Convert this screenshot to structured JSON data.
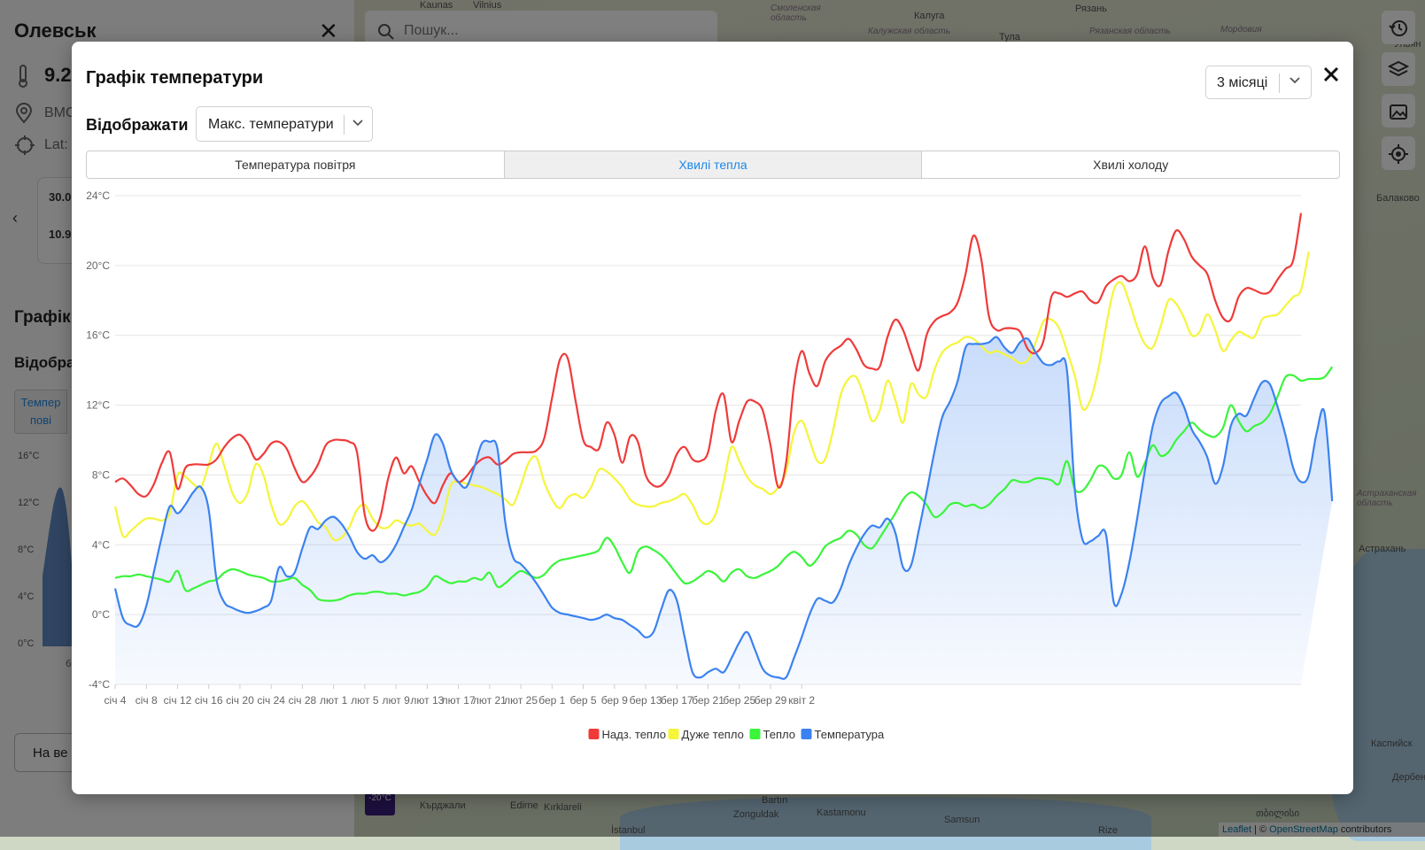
{
  "map": {
    "labels": [
      "Kaunas",
      "Vilnius",
      "Смоленская область",
      "Калуга",
      "Рязань",
      "Тула",
      "Калужская область",
      "Рязанская область",
      "Мордовия",
      "Ульян",
      "Балаково",
      "Астраханская область",
      "Астрахань",
      "Каспийск",
      "Дербент",
      "Bartın",
      "Zonguldak",
      "Kastamonu",
      "Samsun",
      "Edirne",
      "Kırklareli",
      "Кърджали",
      "İstanbul",
      "Rize",
      "თბილისი"
    ],
    "badge": "-20°C"
  },
  "search": {
    "placeholder": "Пошук..."
  },
  "attribution": {
    "leaflet": "Leaflet",
    "sep": " | © ",
    "osm": "OpenStreetMap",
    "rest": " contributors"
  },
  "sidepanel": {
    "title": "Олевськ",
    "temp": "9.2",
    "station": "ВМС",
    "lat": "Lat:",
    "card_top": "30.0",
    "card_bottom": "10.9",
    "chart_heading": "Графік",
    "display_label": "Відобра",
    "tab_label_1": "Темпер",
    "tab_label_2": "пові",
    "y_ticks": [
      "16°C",
      "12°C",
      "8°C",
      "4°C",
      "0°C"
    ],
    "x_tick": "б",
    "button": "На ве"
  },
  "modal": {
    "title": "Графік температури",
    "period": "3 місяці",
    "show_label": "Відображати",
    "select_value": "Макс. температури",
    "tabs": [
      {
        "label": "Температура повітря",
        "active": false
      },
      {
        "label": "Хвилі тепла",
        "active": true
      },
      {
        "label": "Хвилі холоду",
        "active": false
      }
    ]
  },
  "chart_data": {
    "type": "line",
    "ylim": [
      -4,
      24
    ],
    "yticks": [
      "-4°C",
      "0°C",
      "4°C",
      "8°C",
      "12°C",
      "16°C",
      "20°C",
      "24°C"
    ],
    "x_tick_labels": [
      "січ 4",
      "січ 8",
      "січ 12",
      "січ 16",
      "січ 20",
      "січ 24",
      "січ 28",
      "лют 1",
      "лют 5",
      "лют 9",
      "лют 13",
      "лют 17",
      "лют 21",
      "лют 25",
      "бер 1",
      "бер 5",
      "бер 9",
      "бер 13",
      "бер 17",
      "бер 21",
      "бер 25",
      "бер 29",
      "квіт 2"
    ],
    "legend": "bottom-center",
    "grid": true,
    "colors": {
      "extreme": "#f03a3a",
      "strong": "#f5f53a",
      "warm": "#3af53a",
      "temp": "#3b82f0"
    },
    "series": [
      {
        "name": "Надз. тепло",
        "color": "#f03a3a",
        "values": [
          7.6,
          7.8,
          7.4,
          6.9,
          6.8,
          7.5,
          8.7,
          9.3,
          7.2,
          8.4,
          8.6,
          8.6,
          8.6,
          8.9,
          9.6,
          10.1,
          10.3,
          9.8,
          8.9,
          9.2,
          9.8,
          9.9,
          9.5,
          8.4,
          7.6,
          7.9,
          8.6,
          9.7,
          10.0,
          10.0,
          9.9,
          9.3,
          5.7,
          4.8,
          5.6,
          7.8,
          9.0,
          8.1,
          8.5,
          7.6,
          6.8,
          6.4,
          7.4,
          8.1,
          7.6,
          7.9,
          8.5,
          8.9,
          9.0,
          8.6,
          8.8,
          9.2,
          9.3,
          9.3,
          9.4,
          10.1,
          12.4,
          14.6,
          14.7,
          12.3,
          10.0,
          9.6,
          9.5,
          11.0,
          10.3,
          8.7,
          10.2,
          9.9,
          8.0,
          7.4,
          7.4,
          8.0,
          9.2,
          9.6,
          8.9,
          8.8,
          9.3,
          11.7,
          12.6,
          9.9,
          11.1,
          12.2,
          12.2,
          11.7,
          9.7,
          7.3,
          8.7,
          13.1,
          15.1,
          13.8,
          13.1,
          14.5,
          15.1,
          15.4,
          15.8,
          15.2,
          14.3,
          14.1,
          14.2,
          15.9,
          16.9,
          16.3,
          15.0,
          14.0,
          16.0,
          16.8,
          17.1,
          17.3,
          17.9,
          19.5,
          21.7,
          20.4,
          17.1,
          16.3,
          16.4,
          16.4,
          16.2,
          15.2,
          15.0,
          15.7,
          18.2,
          18.4,
          18.2,
          18.4,
          18.5,
          18.0,
          17.9,
          18.8,
          19.2,
          19.4,
          19.1,
          19.5,
          21.1,
          19.3,
          18.9,
          20.8,
          22.0,
          21.5,
          20.5,
          20.0,
          19.5,
          18.0,
          17.0,
          16.9,
          18.2,
          18.7,
          18.6,
          18.4,
          18.5,
          19.2,
          19.8,
          20.3,
          23.0
        ]
      },
      {
        "name": "Дуже тепло",
        "color": "#f5f53a",
        "values": [
          6.2,
          4.5,
          4.8,
          5.2,
          5.5,
          5.5,
          5.4,
          5.8,
          8.0,
          7.9,
          7.5,
          7.3,
          8.6,
          9.8,
          8.5,
          7.0,
          6.4,
          7.0,
          8.6,
          8.0,
          6.3,
          5.2,
          5.4,
          6.2,
          6.5,
          6.0,
          5.3,
          5.0,
          4.3,
          4.4,
          5.0,
          6.0,
          6.3,
          5.5,
          5.0,
          5.0,
          5.4,
          5.2,
          5.1,
          5.2,
          4.8,
          4.6,
          5.6,
          7.4,
          7.6,
          7.5,
          7.4,
          7.3,
          7.1,
          6.9,
          6.6,
          6.3,
          7.4,
          8.7,
          9.0,
          7.6,
          6.6,
          6.1,
          6.7,
          6.9,
          6.7,
          7.3,
          8.3,
          8.2,
          7.8,
          7.3,
          6.6,
          6.3,
          6.2,
          6.2,
          6.4,
          6.5,
          6.7,
          6.9,
          6.3,
          5.4,
          5.2,
          5.8,
          7.6,
          9.6,
          8.8,
          7.9,
          7.4,
          7.2,
          6.9,
          7.3,
          8.2,
          10.4,
          11.1,
          10.0,
          8.8,
          8.9,
          10.5,
          12.6,
          13.5,
          13.6,
          12.5,
          11.1,
          11.7,
          13.4,
          12.3,
          11.0,
          13.2,
          12.6,
          12.5,
          14.0,
          15.0,
          15.4,
          15.6,
          15.9,
          15.8,
          15.4,
          15.0,
          15.1,
          14.9,
          14.7,
          14.4,
          14.6,
          15.6,
          16.8,
          16.9,
          16.4,
          15.1,
          13.7,
          11.8,
          12.3,
          14.0,
          16.5,
          18.6,
          19.0,
          17.9,
          16.5,
          15.5,
          15.3,
          16.5,
          18.0,
          17.8,
          17.0,
          16.0,
          16.2,
          17.2,
          16.3,
          15.1,
          15.7,
          16.2,
          16.0,
          15.9,
          16.9,
          17.1,
          17.2,
          17.7,
          18.2,
          18.6,
          20.8
        ]
      },
      {
        "name": "Тепло",
        "color": "#3af53a",
        "values": [
          2.1,
          2.2,
          2.2,
          2.3,
          2.2,
          2.1,
          2.0,
          1.9,
          2.5,
          1.4,
          1.5,
          1.7,
          1.9,
          2.0,
          2.4,
          2.6,
          2.5,
          2.3,
          2.2,
          2.1,
          1.9,
          1.9,
          2.0,
          2.1,
          1.7,
          1.4,
          0.9,
          0.8,
          0.8,
          0.9,
          1.1,
          1.2,
          1.2,
          1.3,
          1.3,
          1.2,
          1.2,
          1.1,
          1.2,
          1.3,
          1.6,
          2.2,
          2.0,
          1.8,
          1.9,
          1.9,
          2.1,
          2.0,
          2.4,
          1.6,
          1.8,
          2.2,
          2.5,
          2.3,
          2.1,
          2.3,
          2.8,
          3.1,
          3.2,
          3.3,
          3.4,
          3.5,
          3.7,
          4.4,
          3.9,
          3.0,
          2.4,
          3.6,
          3.9,
          3.7,
          3.4,
          2.9,
          2.3,
          1.8,
          1.9,
          2.2,
          2.5,
          2.3,
          1.9,
          2.4,
          2.6,
          2.2,
          2.1,
          2.3,
          2.5,
          2.8,
          3.3,
          3.6,
          3.3,
          2.8,
          3.2,
          3.9,
          4.2,
          4.4,
          4.8,
          4.6,
          4.0,
          3.8,
          4.4,
          5.1,
          5.8,
          6.6,
          7.0,
          6.8,
          6.3,
          5.6,
          5.8,
          6.3,
          6.4,
          6.2,
          6.3,
          6.1,
          6.3,
          6.8,
          7.2,
          7.7,
          7.6,
          7.6,
          7.8,
          7.8,
          7.7,
          7.5,
          8.8,
          7.2,
          7.1,
          7.7,
          8.5,
          8.4,
          7.8,
          8.0,
          9.3,
          7.9,
          8.7,
          9.7,
          9.1,
          9.3,
          10.0,
          10.5,
          11.0,
          10.6,
          10.3,
          10.2,
          10.7,
          12.0,
          11.1,
          10.5,
          10.8,
          11.0,
          11.5,
          12.5,
          13.6,
          13.7,
          13.4,
          13.5,
          13.5,
          13.6,
          14.2
        ]
      },
      {
        "name": "Температура",
        "color": "#3b82f0",
        "values": [
          1.5,
          -0.2,
          -0.6,
          -0.6,
          0.5,
          2.5,
          4.5,
          6.2,
          5.8,
          6.3,
          7.0,
          7.3,
          6.0,
          2.0,
          0.7,
          0.4,
          0.2,
          0.1,
          0.2,
          0.4,
          0.8,
          2.7,
          2.2,
          2.4,
          3.8,
          5.0,
          4.9,
          5.4,
          5.6,
          5.2,
          4.5,
          3.6,
          3.2,
          3.4,
          3.0,
          3.3,
          4.0,
          5.0,
          6.0,
          7.5,
          8.9,
          10.3,
          9.8,
          8.3,
          7.6,
          7.3,
          8.4,
          9.8,
          9.9,
          9.5,
          5.3,
          3.3,
          2.9,
          2.4,
          1.8,
          1.1,
          0.4,
          0.1,
          0.0,
          -0.1,
          -0.2,
          -0.3,
          -0.2,
          0.0,
          -0.2,
          -0.3,
          -0.6,
          -0.9,
          -1.3,
          -1.0,
          0.3,
          1.4,
          0.8,
          -1.3,
          -3.3,
          -3.6,
          -3.3,
          -3.1,
          -3.3,
          -2.5,
          -1.6,
          -1.0,
          -2.0,
          -3.1,
          -3.5,
          -3.6,
          -3.6,
          -2.5,
          -1.3,
          0.0,
          0.9,
          0.8,
          0.7,
          1.5,
          2.8,
          3.8,
          4.6,
          5.1,
          5.0,
          5.5,
          4.7,
          2.7,
          2.8,
          4.8,
          7.0,
          9.3,
          11.3,
          12.2,
          13.4,
          15.3,
          15.5,
          15.5,
          15.6,
          15.9,
          15.3,
          15.0,
          15.6,
          15.8,
          15.0,
          14.4,
          14.3,
          14.5,
          14.0,
          7.2,
          4.3,
          4.2,
          4.5,
          4.6,
          0.7,
          1.2,
          3.0,
          5.5,
          8.3,
          10.8,
          12.1,
          12.5,
          12.7,
          11.9,
          10.6,
          9.9,
          9.0,
          7.5,
          8.5,
          10.8,
          11.5,
          11.4,
          12.4,
          13.3,
          13.2,
          11.9,
          10.3,
          8.4,
          7.6,
          8.0,
          10.4,
          11.6,
          6.5
        ]
      }
    ],
    "legend_entries": [
      "Надз. тепло",
      "Дуже тепло",
      "Тепло",
      "Температура"
    ]
  }
}
